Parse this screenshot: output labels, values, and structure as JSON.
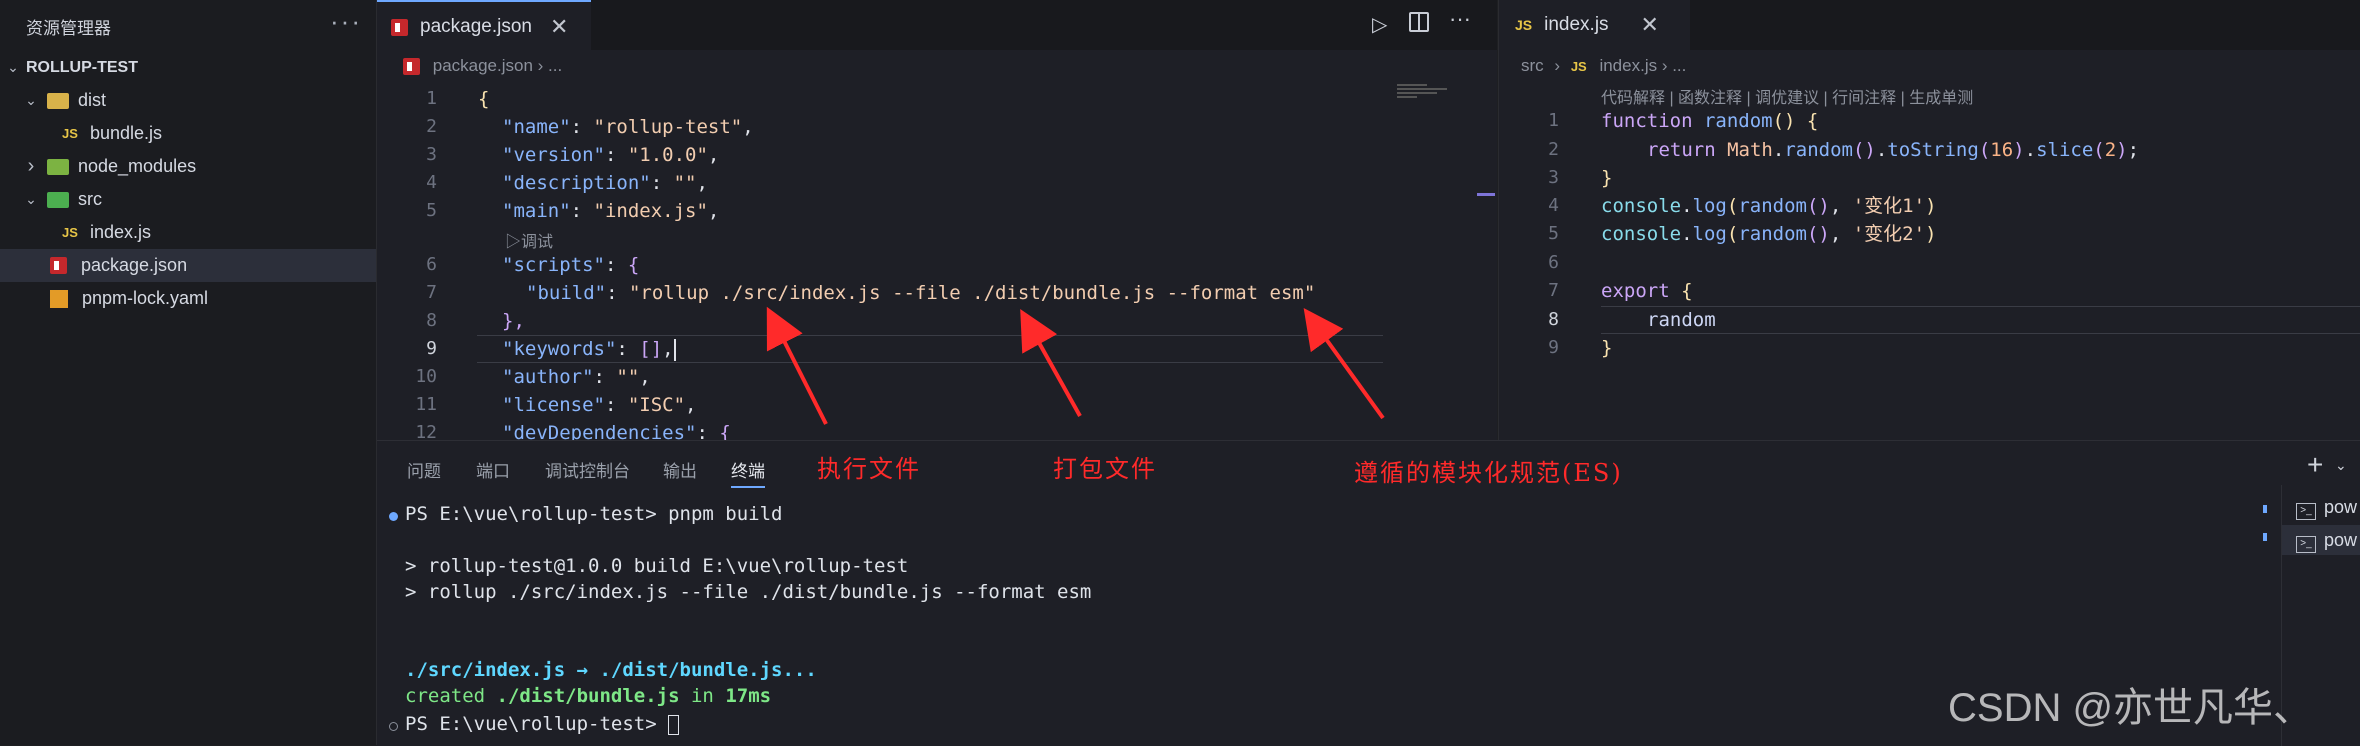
{
  "explorer": {
    "title": "资源管理器",
    "more": "···",
    "project": "ROLLUP-TEST",
    "items": [
      {
        "label": "dist",
        "chev": "⌄",
        "icon": "folder-dist-icon"
      },
      {
        "label": "bundle.js",
        "icon": "js-file-icon",
        "badge": "JS"
      },
      {
        "label": "node_modules",
        "chev": "›",
        "icon": "folder-node-icon"
      },
      {
        "label": "src",
        "chev": "⌄",
        "icon": "folder-src-icon"
      },
      {
        "label": "index.js",
        "icon": "js-file-icon",
        "badge": "JS"
      },
      {
        "label": "package.json",
        "icon": "npm-file-icon"
      },
      {
        "label": "pnpm-lock.yaml",
        "icon": "yaml-file-icon"
      }
    ]
  },
  "editor1": {
    "tab_label": "package.json",
    "breadcrumb_file": "package.json",
    "breadcrumb_rest": "› ...",
    "codelens": "▷调试",
    "line_numbers": [
      "1",
      "2",
      "3",
      "4",
      "5",
      "6",
      "7",
      "8",
      "9",
      "10",
      "11",
      "12"
    ],
    "lines": {
      "l1": "{",
      "l2_key": "\"name\"",
      "l2_val": "\"rollup-test\"",
      "l3_key": "\"version\"",
      "l3_val": "\"1.0.0\"",
      "l4_key": "\"description\"",
      "l4_val": "\"\"",
      "l5_key": "\"main\"",
      "l5_val": "\"index.js\"",
      "l6_key": "\"scripts\"",
      "l7_key": "\"build\"",
      "l7_val": "\"rollup ./src/index.js --file ./dist/bundle.js --format esm\"",
      "l8": "},",
      "l9_key": "\"keywords\"",
      "l9_val": "[]",
      "l10_key": "\"author\"",
      "l10_val": "\"\"",
      "l11_key": "\"license\"",
      "l11_val": "\"ISC\"",
      "l12_key": "\"devDependencies\""
    }
  },
  "editor2": {
    "tab_label": "index.js",
    "tab_badge": "JS",
    "breadcrumb_src": "src",
    "breadcrumb_file": "index.js",
    "breadcrumb_rest": "› ...",
    "codelens": "代码解释 | 函数注释 | 调优建议 | 行间注释 | 生成单测",
    "line_numbers": [
      "1",
      "2",
      "3",
      "4",
      "5",
      "6",
      "7",
      "8",
      "9"
    ],
    "code": {
      "l1_kw": "function",
      "l1_fn": "random",
      "l1_rest": "() {",
      "l2_kw": "return",
      "l2_obj": "Math",
      "l2_fn1": "random",
      "l2_fn2": "toString",
      "l2_num": "16",
      "l2_fn3": "slice",
      "l2_num2": "2",
      "l3": "}",
      "l4_obj": "console",
      "l4_fn": "log",
      "l4_arg": "random",
      "l4_str": "'变化1'",
      "l5_obj": "console",
      "l5_fn": "log",
      "l5_arg": "random",
      "l5_str": "'变化2'",
      "l7_kw": "export",
      "l7_rest": "{",
      "l8": "random",
      "l9": "}"
    }
  },
  "panel": {
    "tabs": [
      "问题",
      "端口",
      "调试控制台",
      "输出",
      "终端"
    ],
    "active_tab": "终端",
    "terminals": [
      "pow",
      "pow"
    ],
    "terminal_lines": {
      "t1": "PS E:\\vue\\rollup-test> pnpm build",
      "t2": "> rollup-test@1.0.0 build E:\\vue\\rollup-test",
      "t3": "> rollup ./src/index.js --file ./dist/bundle.js --format esm",
      "t4": "./src/index.js → ./dist/bundle.js...",
      "t5a": "created ",
      "t5b": "./dist/bundle.js",
      "t5c": " in ",
      "t5d": "17ms",
      "t6": "PS E:\\vue\\rollup-test> "
    }
  },
  "annotations": {
    "a1": "执行文件",
    "a2": "打包文件",
    "a3": "遵循的模块化规范(ES)"
  },
  "watermark": "CSDN @亦世凡华、",
  "colors": {
    "accent": "#6ea8ff",
    "annotation": "#ff2a2a",
    "npm_red": "#c5282c",
    "js_yellow": "#e7c547"
  }
}
